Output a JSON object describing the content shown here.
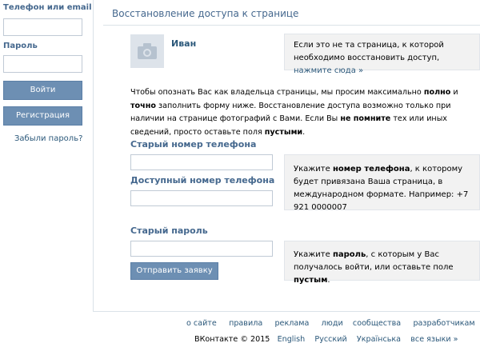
{
  "login": {
    "phone_email_label": "Телефон или email",
    "password_label": "Пароль",
    "login_button": "Войти",
    "register_button": "Регистрация",
    "forgot_link": "Забыли пароль?"
  },
  "main": {
    "title": "Восстановление доступа к странице",
    "user_name": "Иван",
    "not_your_page_text": "Если это не та страница, к которой необходимо восстановить доступ,",
    "not_your_page_link": "нажмите сюда »",
    "intro": {
      "p1": "Чтобы опознать Вас как владельца страницы, мы просим максимально ",
      "b1": "полно",
      "p2": " и ",
      "b2": "точно",
      "p3": " заполнить форму ниже. Восстановление доступа возможно только при наличии на странице фотографий с Вами. Если Вы ",
      "b3": "не помните",
      "p4": " тех или иных сведений, просто оставьте поля ",
      "b4": "пустыми",
      "p5": "."
    },
    "old_phone_label": "Старый номер телефона",
    "available_phone_label": "Доступный номер телефона",
    "phone_hint": {
      "p1": "Укажите ",
      "b1": "номер телефона",
      "p2": ", к которому будет привязана Ваша страница, в международном формате. Например: +7 921 0000007"
    },
    "old_password_label": "Старый пароль",
    "password_hint": {
      "p1": "Укажите ",
      "b1": "пароль",
      "p2": ", с которым у Вас получалось войти, или оставьте поле ",
      "b2": "пустым",
      "p3": "."
    },
    "submit_button": "Отправить заявку"
  },
  "footer": {
    "links": [
      "о сайте",
      "правила",
      "реклама",
      "люди",
      "сообщества",
      "разработчикам"
    ],
    "brand": "ВКонтакте © 2015",
    "languages": [
      "English",
      "Русский",
      "Українська",
      "все языки »"
    ]
  },
  "colors": {
    "accent": "#45688e",
    "link": "#2b587a",
    "button": "#6d8fb3",
    "hint_box": "#f2f2f2"
  },
  "icons": [
    "camera-icon"
  ]
}
